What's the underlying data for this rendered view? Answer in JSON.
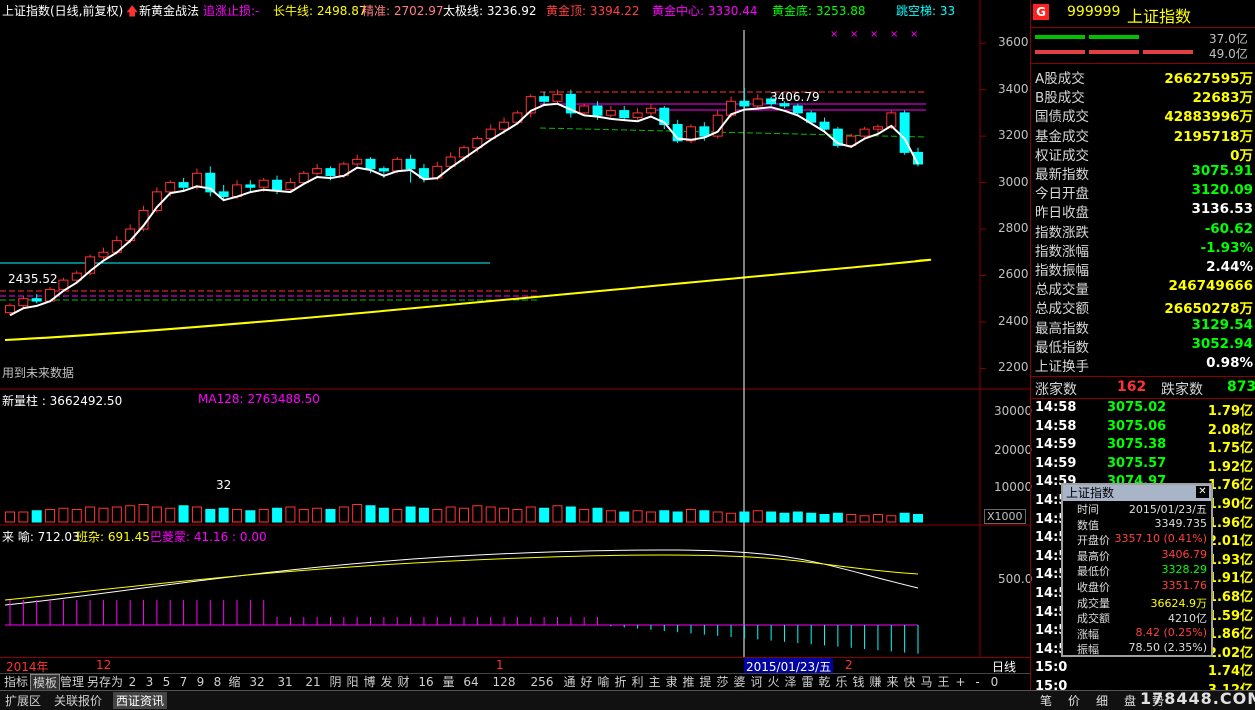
{
  "header": {
    "title": "上证指数(日线,前复权)",
    "indicator_name": "新黄金战法",
    "stop_loss": "追涨止损:-",
    "long_bull": "长牛线: 2498.87",
    "precise": "精准: 2702.97",
    "taiji": "太极线: 3236.92",
    "gold_top": "黄金顶: 3394.22",
    "gold_center": "黄金中心: 3330.44",
    "gold_bottom": "黄金底: 3253.88",
    "jump_ladder": "跳空梯: 33"
  },
  "colors": {
    "up": "#ff3232",
    "down": "#00ffff",
    "yellow": "#ffff00",
    "magenta": "#ff00ff",
    "green": "#00ff00",
    "bg": "#000000"
  },
  "price_axis": [
    "3600",
    "3400",
    "3200",
    "3000",
    "2800",
    "2600",
    "2400",
    "2200"
  ],
  "volume_axis": [
    "30000",
    "20000",
    "10000"
  ],
  "volume_unit": "X1000",
  "ind_axis": [
    "500.0"
  ],
  "low_label": "2435.52",
  "high_label": "3406.79",
  "future_note": "用到未来数据",
  "volume_header": {
    "name": "新量柱 : 3662492.50",
    "ma": "MA128: 2763488.50"
  },
  "ind_header": {
    "a": "来 喻: 712.03",
    "b": "班杂: 691.45",
    "c": "巴菱蒙: 41.16 : 0.00"
  },
  "vol_annot": "32",
  "date_axis": {
    "year": "2014年",
    "m12": "12",
    "m1": "1",
    "m2": "2",
    "cursor": "2015/01/23/五"
  },
  "chart_data": {
    "type": "candlestick",
    "ylim": [
      2150,
      3700
    ],
    "candles": [
      [
        2440,
        2470,
        2480,
        2430
      ],
      [
        2470,
        2500,
        2510,
        2460
      ],
      [
        2500,
        2490,
        2520,
        2480
      ],
      [
        2490,
        2540,
        2550,
        2485
      ],
      [
        2540,
        2580,
        2590,
        2530
      ],
      [
        2580,
        2610,
        2620,
        2570
      ],
      [
        2610,
        2680,
        2690,
        2600
      ],
      [
        2680,
        2700,
        2720,
        2670
      ],
      [
        2700,
        2750,
        2770,
        2690
      ],
      [
        2750,
        2800,
        2820,
        2740
      ],
      [
        2800,
        2880,
        2900,
        2790
      ],
      [
        2880,
        2960,
        2980,
        2870
      ],
      [
        2960,
        3000,
        3010,
        2940
      ],
      [
        3000,
        2980,
        3020,
        2960
      ],
      [
        2980,
        3040,
        3060,
        2970
      ],
      [
        3040,
        2960,
        3070,
        2940
      ],
      [
        2960,
        2940,
        2990,
        2920
      ],
      [
        2940,
        2990,
        3010,
        2930
      ],
      [
        2990,
        2980,
        3010,
        2960
      ],
      [
        2980,
        3010,
        3020,
        2960
      ],
      [
        3010,
        2970,
        3030,
        2950
      ],
      [
        2970,
        3000,
        3020,
        2960
      ],
      [
        3000,
        3040,
        3050,
        2990
      ],
      [
        3040,
        3060,
        3080,
        3030
      ],
      [
        3060,
        3030,
        3070,
        3010
      ],
      [
        3030,
        3080,
        3090,
        3020
      ],
      [
        3080,
        3100,
        3120,
        3070
      ],
      [
        3100,
        3060,
        3110,
        3040
      ],
      [
        3060,
        3050,
        3070,
        3020
      ],
      [
        3050,
        3100,
        3110,
        3040
      ],
      [
        3100,
        3060,
        3120,
        3000
      ],
      [
        3060,
        3020,
        3080,
        3000
      ],
      [
        3020,
        3070,
        3090,
        3010
      ],
      [
        3070,
        3110,
        3130,
        3060
      ],
      [
        3110,
        3150,
        3160,
        3090
      ],
      [
        3150,
        3190,
        3200,
        3130
      ],
      [
        3190,
        3230,
        3250,
        3180
      ],
      [
        3230,
        3260,
        3280,
        3210
      ],
      [
        3260,
        3300,
        3310,
        3250
      ],
      [
        3300,
        3370,
        3380,
        3280
      ],
      [
        3370,
        3350,
        3390,
        3330
      ],
      [
        3350,
        3380,
        3400,
        3340
      ],
      [
        3380,
        3300,
        3400,
        3280
      ],
      [
        3300,
        3330,
        3340,
        3290
      ],
      [
        3330,
        3290,
        3350,
        3270
      ],
      [
        3290,
        3310,
        3330,
        3280
      ],
      [
        3310,
        3280,
        3330,
        3270
      ],
      [
        3280,
        3300,
        3320,
        3270
      ],
      [
        3300,
        3320,
        3340,
        3290
      ],
      [
        3320,
        3250,
        3330,
        3230
      ],
      [
        3250,
        3180,
        3270,
        3170
      ],
      [
        3180,
        3240,
        3250,
        3170
      ],
      [
        3240,
        3200,
        3260,
        3180
      ],
      [
        3200,
        3290,
        3310,
        3190
      ],
      [
        3290,
        3350,
        3370,
        3280
      ],
      [
        3350,
        3330,
        3407,
        3310
      ],
      [
        3330,
        3360,
        3380,
        3320
      ],
      [
        3360,
        3340,
        3370,
        3330
      ],
      [
        3340,
        3330,
        3350,
        3320
      ],
      [
        3330,
        3300,
        3340,
        3290
      ],
      [
        3300,
        3260,
        3310,
        3250
      ],
      [
        3260,
        3230,
        3280,
        3220
      ],
      [
        3230,
        3160,
        3240,
        3150
      ],
      [
        3160,
        3200,
        3210,
        3150
      ],
      [
        3200,
        3230,
        3240,
        3190
      ],
      [
        3230,
        3240,
        3250,
        3210
      ],
      [
        3240,
        3300,
        3310,
        3230
      ],
      [
        3300,
        3130,
        3310,
        3120
      ],
      [
        3130,
        3080,
        3150,
        3070
      ]
    ],
    "volume": [
      8,
      8,
      9,
      10,
      11,
      10,
      12,
      11,
      12,
      13,
      14,
      12,
      11,
      13,
      12,
      10,
      11,
      10,
      9,
      10,
      11,
      12,
      10,
      11,
      10,
      12,
      14,
      13,
      11,
      10,
      12,
      11,
      10,
      12,
      11,
      13,
      12,
      11,
      10,
      12,
      11,
      13,
      12,
      10,
      11,
      9,
      8,
      9,
      8,
      9,
      8,
      10,
      9,
      8,
      7,
      8,
      9,
      8,
      7,
      8,
      7,
      6,
      7,
      6,
      5,
      6,
      5,
      7,
      6
    ]
  },
  "right_panel": {
    "code": "999999",
    "name": "上证指数",
    "pct1": "37.0亿",
    "pct2": "49.0亿",
    "rows": [
      {
        "label": "A股成交",
        "value": "26627595万",
        "color": "#ffff00"
      },
      {
        "label": "B股成交",
        "value": "22683万",
        "color": "#ffff00"
      },
      {
        "label": "国债成交",
        "value": "42883996万",
        "color": "#ffff00"
      },
      {
        "label": "基金成交",
        "value": "2195718万",
        "color": "#ffff00"
      },
      {
        "label": "权证成交",
        "value": "0万",
        "color": "#ffff00"
      },
      {
        "label": "最新指数",
        "value": "3075.91",
        "color": "#00ff00"
      },
      {
        "label": "今日开盘",
        "value": "3120.09",
        "color": "#00ff00"
      },
      {
        "label": "昨日收盘",
        "value": "3136.53",
        "color": "#ffffff"
      },
      {
        "label": "指数涨跌",
        "value": "-60.62",
        "color": "#00ff00"
      },
      {
        "label": "指数涨幅",
        "value": "-1.93%",
        "color": "#00ff00"
      },
      {
        "label": "指数振幅",
        "value": "2.44%",
        "color": "#ffffff"
      },
      {
        "label": "总成交量",
        "value": "246749666",
        "color": "#ffff00"
      },
      {
        "label": "总成交额",
        "value": "26650278万",
        "color": "#ffff00"
      },
      {
        "label": "最高指数",
        "value": "3129.54",
        "color": "#00ff00"
      },
      {
        "label": "最低指数",
        "value": "3052.94",
        "color": "#00ff00"
      },
      {
        "label": "上证换手",
        "value": "0.98%",
        "color": "#ffffff"
      }
    ],
    "rise_label": "涨家数",
    "rise_val": "162",
    "fall_label": "跌家数",
    "fall_val": "873",
    "ticks": [
      {
        "t": "14:58",
        "p": "3075.02",
        "v": "1.79亿"
      },
      {
        "t": "14:58",
        "p": "3075.06",
        "v": "2.08亿"
      },
      {
        "t": "14:59",
        "p": "3075.38",
        "v": "1.75亿"
      },
      {
        "t": "14:59",
        "p": "3075.57",
        "v": "1.92亿"
      },
      {
        "t": "14:59",
        "p": "3074.97",
        "v": "1.76亿"
      },
      {
        "t": "14:5",
        "p": "",
        "v": "1.90亿"
      },
      {
        "t": "14:5",
        "p": "",
        "v": "1.96亿"
      },
      {
        "t": "14:5",
        "p": "",
        "v": "2.01亿"
      },
      {
        "t": "14:5",
        "p": "",
        "v": "1.93亿"
      },
      {
        "t": "14:5",
        "p": "",
        "v": "1.91亿"
      },
      {
        "t": "14:5",
        "p": "",
        "v": "1.68亿"
      },
      {
        "t": "14:5",
        "p": "",
        "v": "1.59亿"
      },
      {
        "t": "14:5",
        "p": "",
        "v": "1.86亿"
      },
      {
        "t": "14:5",
        "p": "",
        "v": "2.02亿"
      },
      {
        "t": "15:0",
        "p": "",
        "v": "1.74亿"
      },
      {
        "t": "15:0",
        "p": "",
        "v": "3.12亿"
      }
    ],
    "daily_label": "日线"
  },
  "popup": {
    "title": "上证指数",
    "rows": [
      {
        "label": "时间",
        "value": "2015/01/23/五",
        "color": "#dddddd"
      },
      {
        "label": "数值",
        "value": "3349.735",
        "color": "#dddddd"
      },
      {
        "label": "开盘价",
        "value": "3357.10 (0.41%)",
        "color": "#ff4040"
      },
      {
        "label": "最高价",
        "value": "3406.79",
        "color": "#ff4040"
      },
      {
        "label": "最低价",
        "value": "3328.29",
        "color": "#00ff00"
      },
      {
        "label": "收盘价",
        "value": "3351.76",
        "color": "#ff4040"
      },
      {
        "label": "成交量",
        "value": "36624.9万",
        "color": "#ffff00"
      },
      {
        "label": "成交额",
        "value": "4210亿",
        "color": "#dddddd"
      },
      {
        "label": "涨幅",
        "value": "8.42 (0.25%)",
        "color": "#ff4040"
      },
      {
        "label": "振幅",
        "value": "78.50 (2.35%)",
        "color": "#dddddd"
      }
    ]
  },
  "toolbar": [
    "指标",
    "模板",
    "管理",
    "另存为",
    "2",
    "3",
    "5",
    "7",
    "9",
    "8",
    "缩",
    "32",
    "31",
    "21",
    "阴",
    "阳",
    "博",
    "发",
    "财",
    "16",
    "量",
    "64",
    "128",
    "256",
    "通",
    "好",
    "喻",
    "折",
    "利",
    "主",
    "隶",
    "推",
    "提",
    "莎",
    "婆",
    "诃",
    "火",
    "泽",
    "雷",
    "乾",
    "乐",
    "钱",
    "赚",
    "来",
    "快",
    "马",
    "王",
    "+",
    "-",
    "0"
  ],
  "bottom_tabs": [
    "扩展区",
    "关联报价",
    "西证资讯"
  ],
  "bottom_right": [
    "笔",
    "价",
    "细",
    "盘",
    "势",
    "联",
    "值",
    "主"
  ],
  "watermark": "178448.COM"
}
